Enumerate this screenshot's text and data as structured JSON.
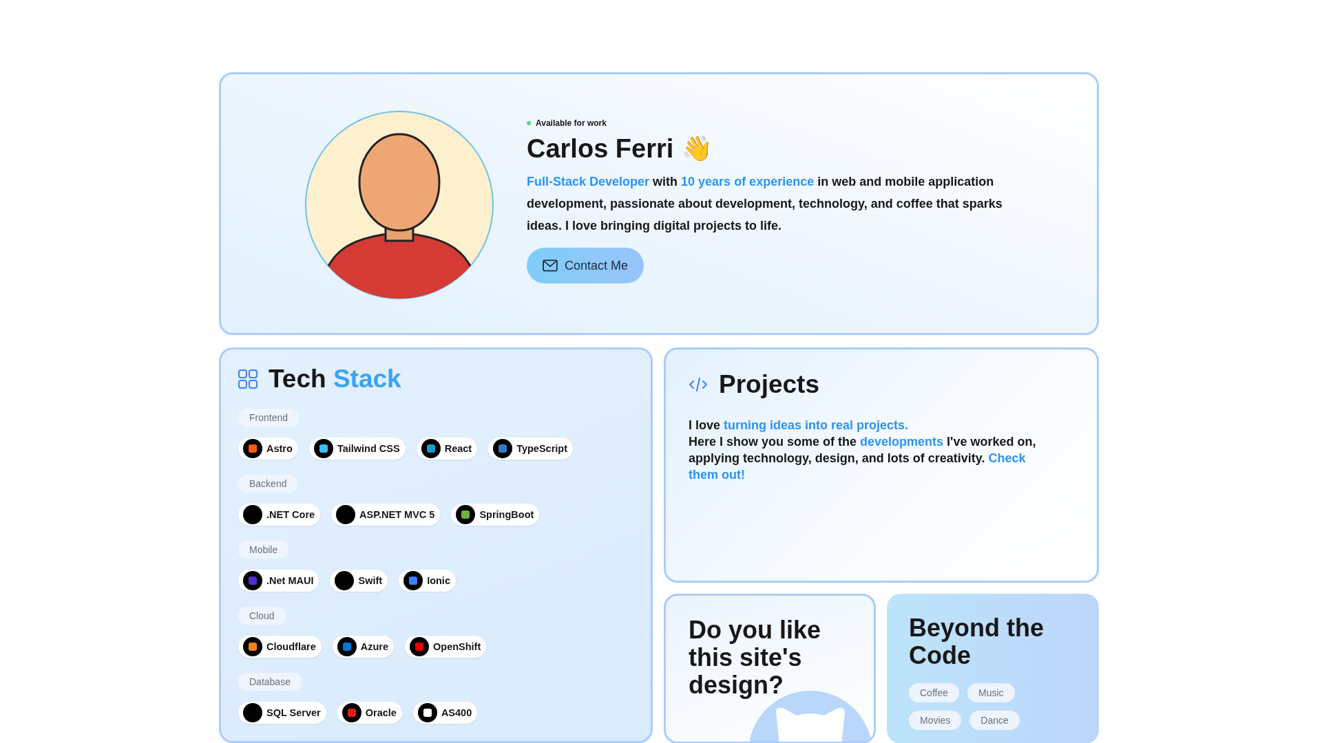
{
  "hero": {
    "status": "Available for work",
    "name": "Carlos Ferri",
    "wave": "👋",
    "bio": "**Full-Stack Developer** with **10 years of experience** in web and mobile application development, passionate about development, technology, and coffee that sparks ideas. I love bringing digital projects to life.",
    "button": "Contact Me"
  },
  "tech_stack": {
    "title": "Tech",
    "title_accent": "Stack",
    "groups": [
      {
        "label": "Frontend",
        "items": [
          {
            "name": "Astro",
            "color": "#ff5d01"
          },
          {
            "name": "Tailwind CSS",
            "color": "#38bdf8"
          },
          {
            "name": "React",
            "color": "#149eca"
          },
          {
            "name": "TypeScript",
            "color": "#3178c6"
          }
        ]
      },
      {
        "label": "Backend",
        "items": [
          {
            "name": ".NET Core",
            "color": "#000000"
          },
          {
            "name": "ASP.NET MVC 5",
            "color": "#000000"
          },
          {
            "name": "SpringBoot",
            "color": "#6db33f"
          }
        ]
      },
      {
        "label": "Mobile",
        "items": [
          {
            "name": ".Net MAUI",
            "color": "#512bd4"
          },
          {
            "name": "Swift",
            "color": "#000000"
          },
          {
            "name": "Ionic",
            "color": "#3880ff"
          }
        ]
      },
      {
        "label": "Cloud",
        "items": [
          {
            "name": "Cloudflare",
            "color": "#f38020"
          },
          {
            "name": "Azure",
            "color": "#0078d4"
          },
          {
            "name": "OpenShift",
            "color": "#ee0000"
          }
        ]
      },
      {
        "label": "Database",
        "items": [
          {
            "name": "SQL Server",
            "color": "#000000"
          },
          {
            "name": "Oracle",
            "color": "#e51b1b"
          },
          {
            "name": "AS400",
            "color": "#ffffff"
          }
        ]
      }
    ]
  },
  "projects": {
    "title": "Projects",
    "text_lines": [
      "I love **turning ideas into real projects.**",
      "Here I show you some of the **developments** I've worked on, applying technology, design, and lots of creativity. **Check them out!**"
    ]
  },
  "design_card": {
    "title": "Do you like this site's design?"
  },
  "beyond": {
    "title": "Beyond the Code",
    "tags": [
      "Coffee",
      "Music",
      "Movies",
      "Dance"
    ]
  }
}
